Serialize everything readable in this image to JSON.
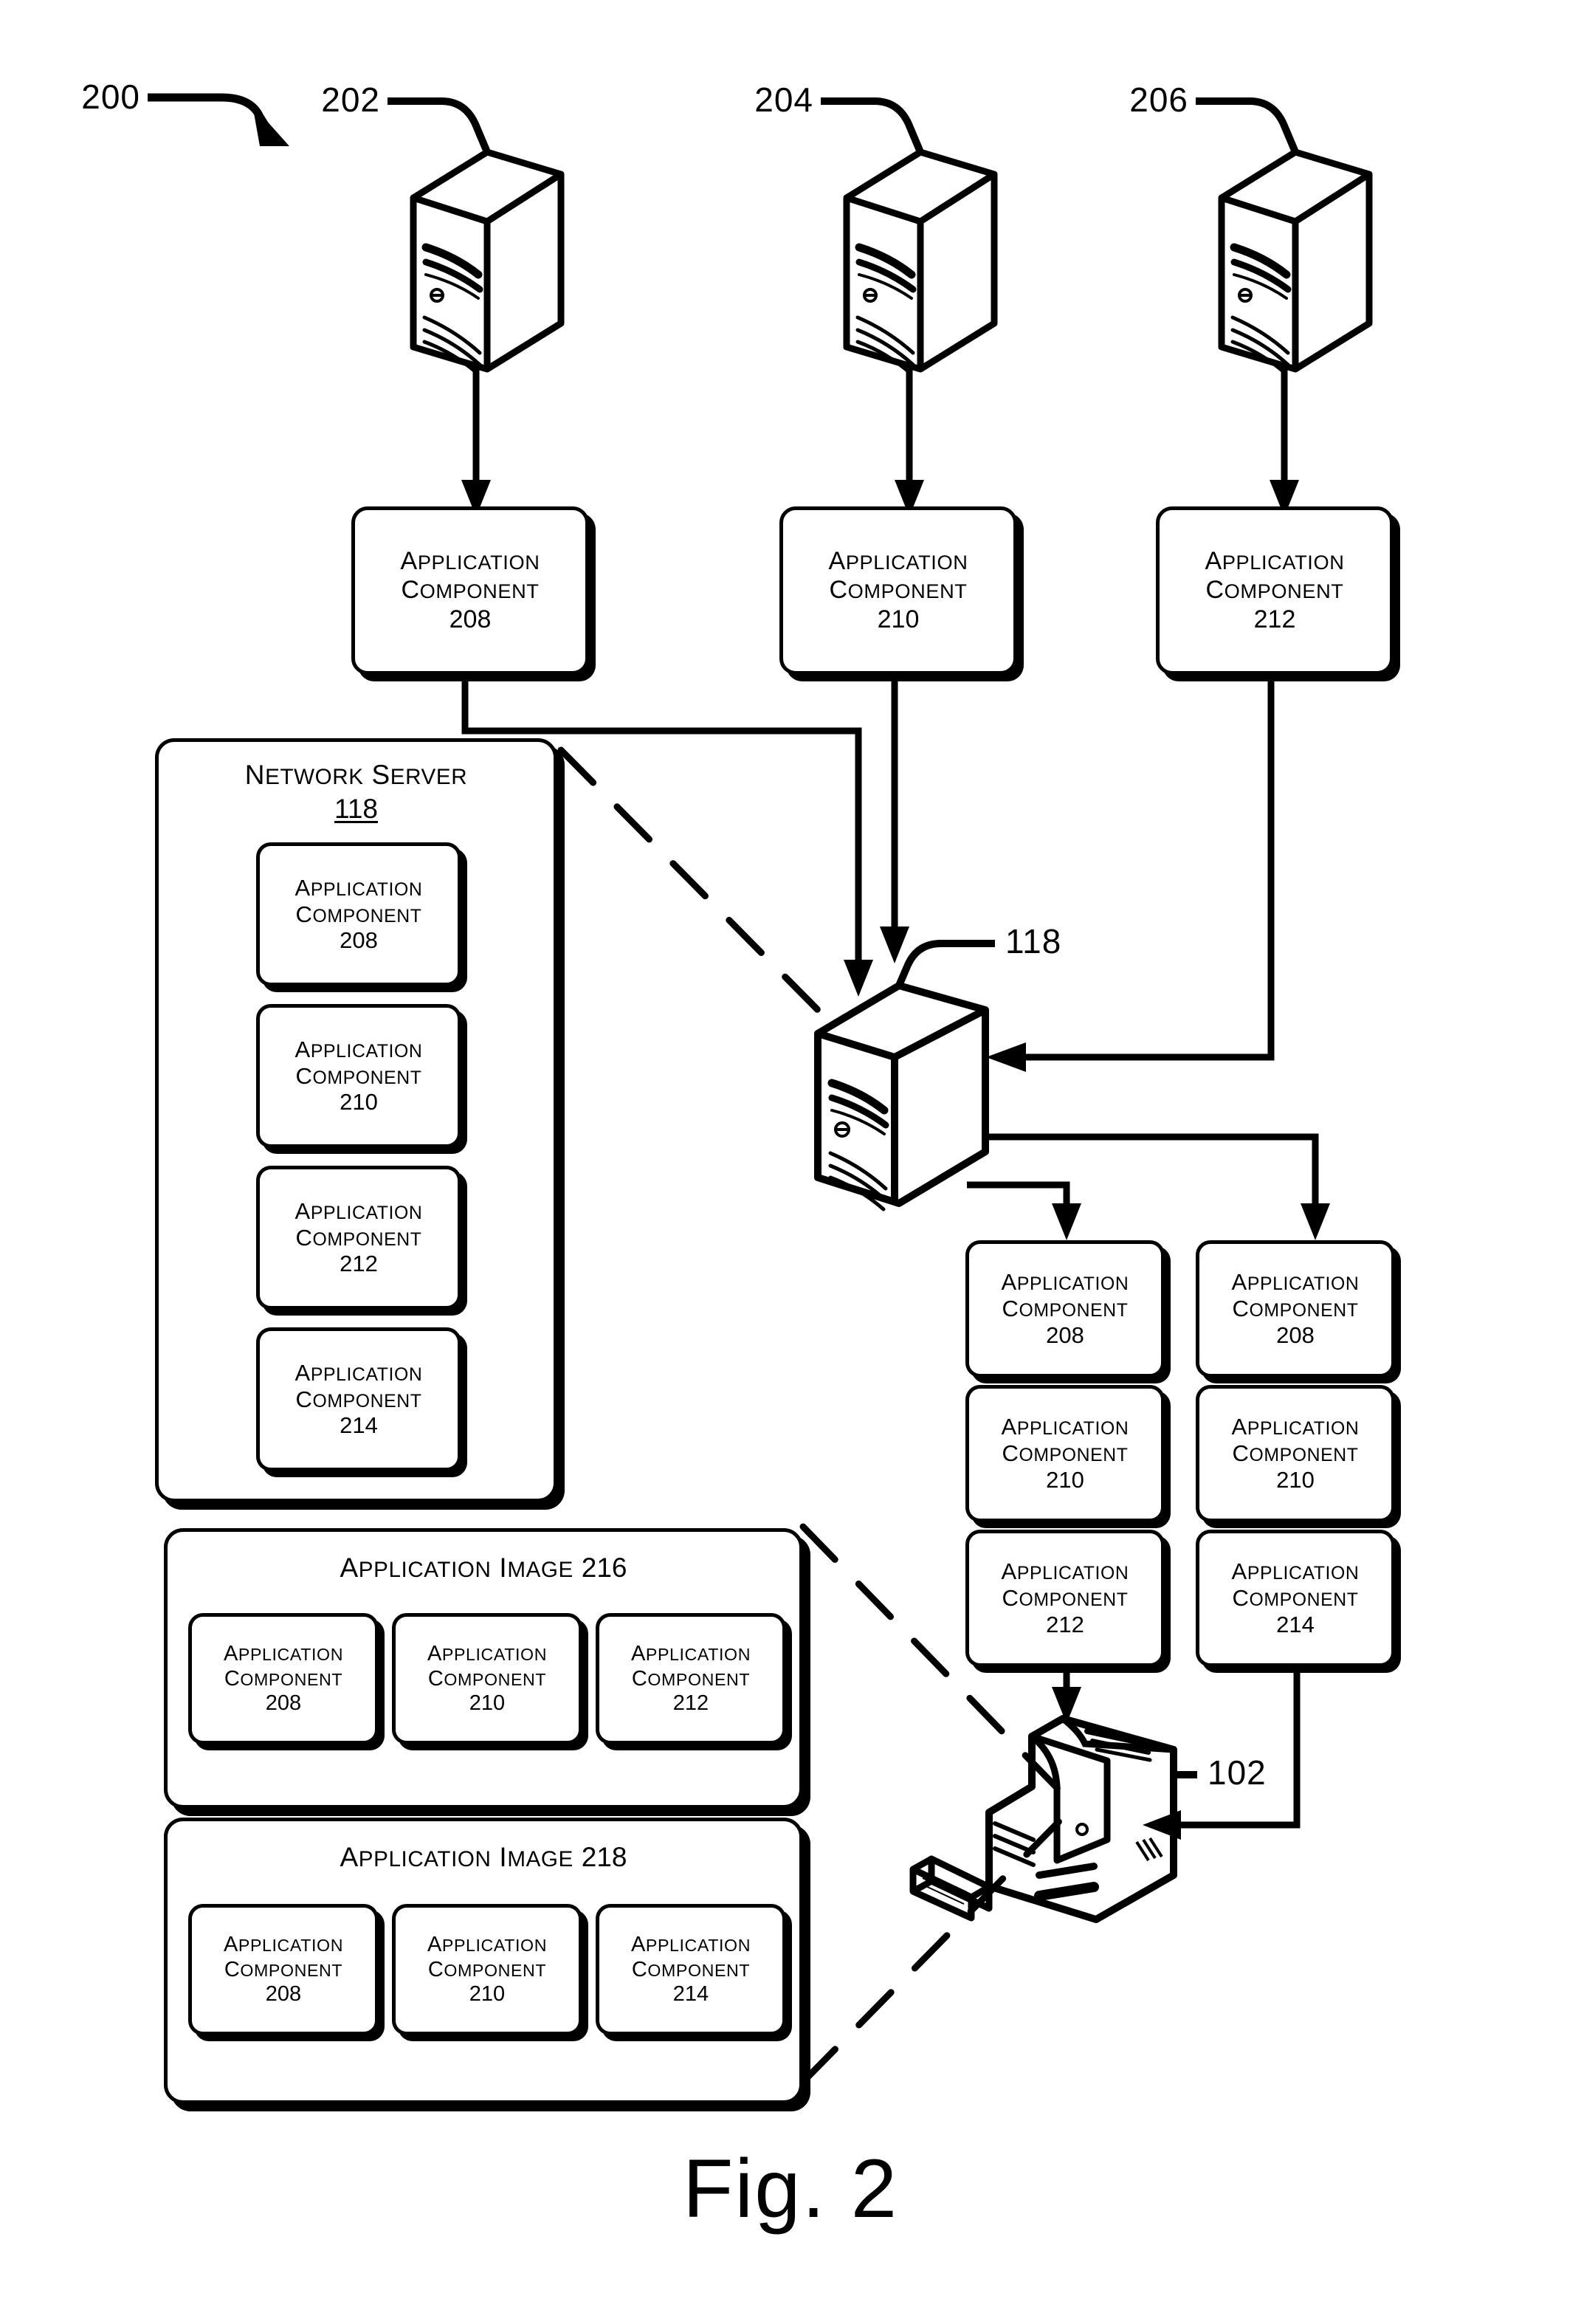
{
  "figure": {
    "caption": "Fig. 2",
    "system_ref": "200"
  },
  "top_servers": [
    {
      "ref": "202",
      "icon": "server-icon"
    },
    {
      "ref": "204",
      "icon": "server-icon"
    },
    {
      "ref": "206",
      "icon": "server-icon"
    }
  ],
  "top_components": [
    {
      "line1": "Application",
      "line2": "Component",
      "num": "208"
    },
    {
      "line1": "Application",
      "line2": "Component",
      "num": "210"
    },
    {
      "line1": "Application",
      "line2": "Component",
      "num": "212"
    }
  ],
  "network_server": {
    "title_line1": "Network Server",
    "title_num": "118",
    "components": [
      {
        "line1": "Application",
        "line2": "Component",
        "num": "208"
      },
      {
        "line1": "Application",
        "line2": "Component",
        "num": "210"
      },
      {
        "line1": "Application",
        "line2": "Component",
        "num": "212"
      },
      {
        "line1": "Application",
        "line2": "Component",
        "num": "214"
      }
    ]
  },
  "central_server": {
    "ref": "118",
    "icon": "server-icon"
  },
  "client_pc": {
    "ref": "102",
    "icon": "desktop-computer-icon"
  },
  "stack_left": [
    {
      "line1": "Application",
      "line2": "Component",
      "num": "208"
    },
    {
      "line1": "Application",
      "line2": "Component",
      "num": "210"
    },
    {
      "line1": "Application",
      "line2": "Component",
      "num": "212"
    }
  ],
  "stack_right": [
    {
      "line1": "Application",
      "line2": "Component",
      "num": "208"
    },
    {
      "line1": "Application",
      "line2": "Component",
      "num": "210"
    },
    {
      "line1": "Application",
      "line2": "Component",
      "num": "214"
    }
  ],
  "application_images": [
    {
      "title_text": "Application Image",
      "title_num": "216",
      "components": [
        {
          "line1": "Application",
          "line2": "Component",
          "num": "208"
        },
        {
          "line1": "Application",
          "line2": "Component",
          "num": "210"
        },
        {
          "line1": "Application",
          "line2": "Component",
          "num": "212"
        }
      ]
    },
    {
      "title_text": "Application Image",
      "title_num": "218",
      "components": [
        {
          "line1": "Application",
          "line2": "Component",
          "num": "208"
        },
        {
          "line1": "Application",
          "line2": "Component",
          "num": "210"
        },
        {
          "line1": "Application",
          "line2": "Component",
          "num": "214"
        }
      ]
    }
  ],
  "colors": {
    "ink": "#000000",
    "paper": "#ffffff"
  }
}
